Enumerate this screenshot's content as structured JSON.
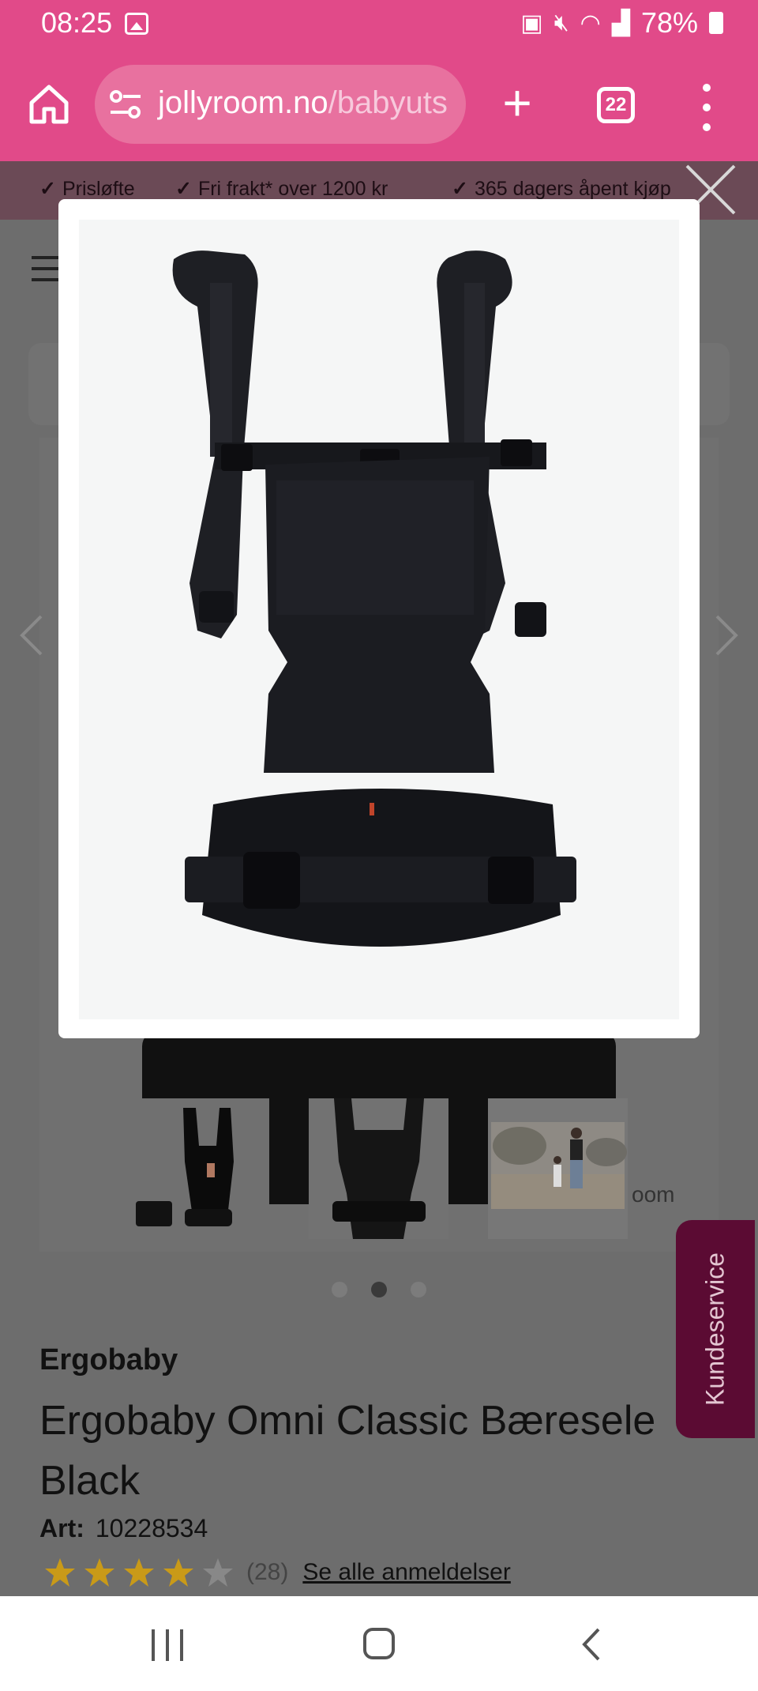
{
  "status_bar": {
    "time": "08:25",
    "battery": "78%",
    "icons": [
      "image-icon",
      "battery-saver-icon",
      "mute-icon",
      "wifi-icon",
      "signal-icon",
      "battery-icon"
    ]
  },
  "browser": {
    "url_host": "jollyroom.no",
    "url_path": "/babyuts",
    "tab_count": "22"
  },
  "usp": [
    "Prisløfte",
    "Fri frakt* over 1200 kr",
    "365 dagers åpent kjøp"
  ],
  "product": {
    "brand": "Ergobaby",
    "title": "Ergobaby Omni Classic Bæresele Black",
    "art_label": "Art:",
    "art_number": "10228534",
    "rating_value": 4,
    "rating_max": 5,
    "review_count": "(28)",
    "reviews_link": "Se alle anmeldelser",
    "bg_room_text": "oom"
  },
  "gallery": {
    "thumbnails": [
      "carrier-with-pouch",
      "carrier-back",
      "family-outdoors"
    ],
    "active_dot": 1,
    "dot_count": 3
  },
  "customer_service": "Kundeservice",
  "colors": {
    "brand_pink": "#e14a89",
    "service_tab": "#5b0b33",
    "star": "#c99a18"
  }
}
